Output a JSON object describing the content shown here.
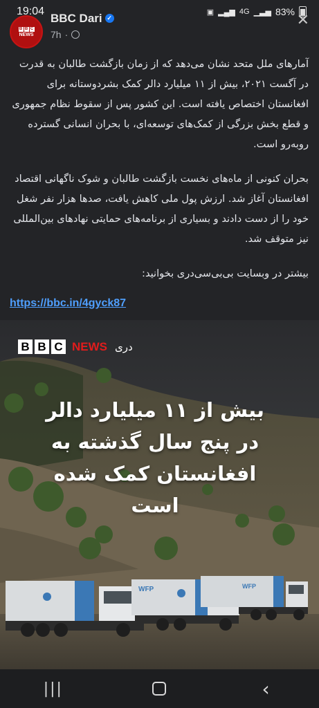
{
  "status_bar": {
    "time": "19:04",
    "battery": "83%",
    "network": "4G"
  },
  "post": {
    "page_name": "BBC Dari",
    "time_ago": "7h",
    "avatar_text": {
      "bbc": [
        "B",
        "B",
        "C"
      ],
      "news": "NEWS"
    },
    "paragraphs": [
      "آمارهای ملل متحد نشان می‌دهد که از زمان بازگشت طالبان به قدرت در آگست ۲۰۲۱، بیش از ۱۱ میلیارد دالر کمک بشردوستانه برای افغانستان اختصاص یافته است. این کشور پس از سقوط نظام جمهوری و قطع بخش بزرگی از کمک‌های توسعه‌ای، با بحران انسانی گسترده روبه‌رو است.",
      "بحران کنونی از ماه‌های نخست بازگشت طالبان و شوک ناگهانی اقتصاد افغانستان آغاز شد. ارزش پول ملی کاهش یافت، صدها هزار نفر شغل خود را از دست دادند و بسیاری از برنامه‌های حمایتی نهادهای بین‌المللی نیز متوقف شد.",
      "بیشتر در وبسایت بی‌بی‌سی‌دری بخوانید:"
    ],
    "link": "https://bbc.in/4gyck87"
  },
  "image": {
    "logo": {
      "blocks": [
        "B",
        "B",
        "C"
      ],
      "news": "NEWS",
      "language": "دری"
    },
    "headline_lines": [
      "بیش از ۱۱ میلیارد دالر",
      "در پنج سال گذشته به",
      "افغانستان کمک شده است"
    ],
    "truck_labels": [
      "WFP",
      "WFP",
      "WFP"
    ]
  },
  "colors": {
    "background": "#232427",
    "link": "#4f9ffe",
    "bbc_red": "#e01c1c"
  }
}
